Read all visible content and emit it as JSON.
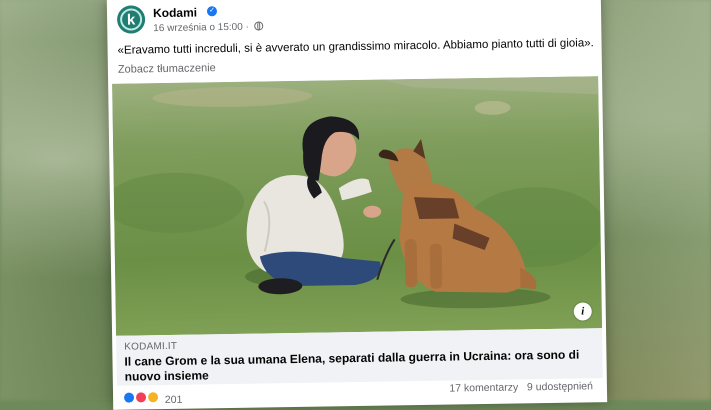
{
  "post": {
    "page_name": "Kodami",
    "avatar_letter": "k",
    "timestamp": "16 września o 15:00",
    "audience_icon": "globe-icon",
    "text": "«Eravamo tutti increduli, si è avverato un grandissimo miracolo. Abbiamo pianto tutti di gioia».",
    "translate_label": "Zobacz tłumaczenie"
  },
  "link_preview": {
    "domain": "KODAMI.IT",
    "title": "Il cane Grom e la sua umana Elena, separati dalla guerra in Ucraina: ora sono di nuovo insieme"
  },
  "stats": {
    "comments": "17 komentarzy",
    "shares": "9 udostępnień",
    "reactions_count": "201"
  },
  "colors": {
    "avatar_bg": "#1f7d72",
    "verified": "#1877f2",
    "link_box_bg": "#f0f2f5",
    "meta_text": "#65676b"
  }
}
